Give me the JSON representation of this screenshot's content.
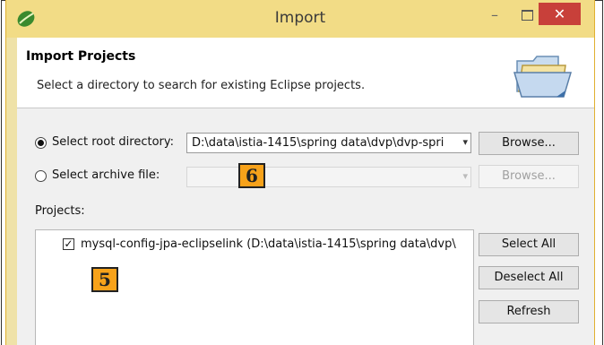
{
  "window": {
    "title": "Import",
    "minimize_glyph": "–",
    "close_glyph": "✕",
    "app_icon": "eclipse-leaf-icon"
  },
  "header": {
    "title": "Import Projects",
    "description": "Select a directory to search for existing Eclipse projects.",
    "icon": "open-folder-icon"
  },
  "source": {
    "root_option": {
      "label": "Select root directory:",
      "selected": true
    },
    "root_value": "D:\\data\\istia-1415\\spring data\\dvp\\dvp-spri",
    "archive_option": {
      "label": "Select archive file:",
      "selected": false
    },
    "archive_value": "",
    "browse_label": "Browse...",
    "browse_archive_label": "Browse..."
  },
  "projects": {
    "label": "Projects:",
    "items": [
      {
        "checked": true,
        "label": "mysql-config-jpa-eclipselink (D:\\data\\istia-1415\\spring data\\dvp\\"
      }
    ],
    "select_all_label": "Select All",
    "deselect_all_label": "Deselect All",
    "refresh_label": "Refresh"
  },
  "annotations": {
    "marker_6": "6",
    "marker_5": "5"
  },
  "colors": {
    "title_bar": "#f2dc86",
    "close_button": "#c8403a",
    "marker_fill": "#f7a21a"
  }
}
